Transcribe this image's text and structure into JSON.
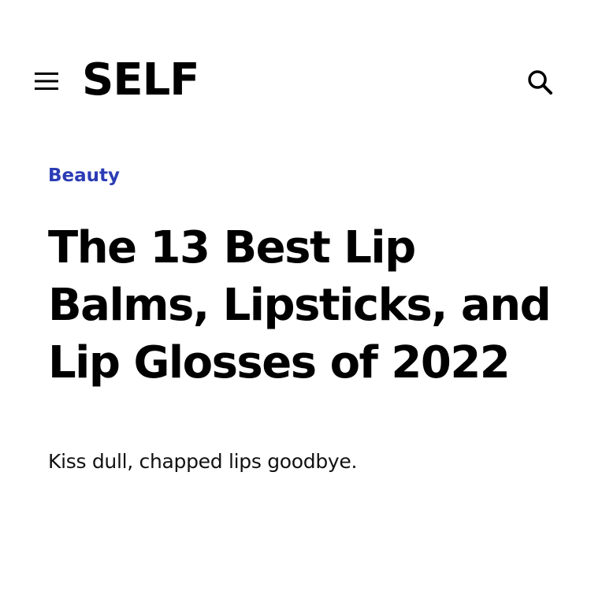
{
  "header": {
    "logo_text": "SELF",
    "menu_icon": "hamburger-menu-icon",
    "search_icon": "search-icon"
  },
  "article": {
    "category": "Beauty",
    "headline": "The 13 Best Lip Balms, Lipsticks, and Lip Glosses of 2022",
    "dek": "Kiss dull, chapped lips goodbye."
  },
  "colors": {
    "category_link": "#2b3cb5",
    "text": "#000000",
    "background": "#ffffff"
  }
}
